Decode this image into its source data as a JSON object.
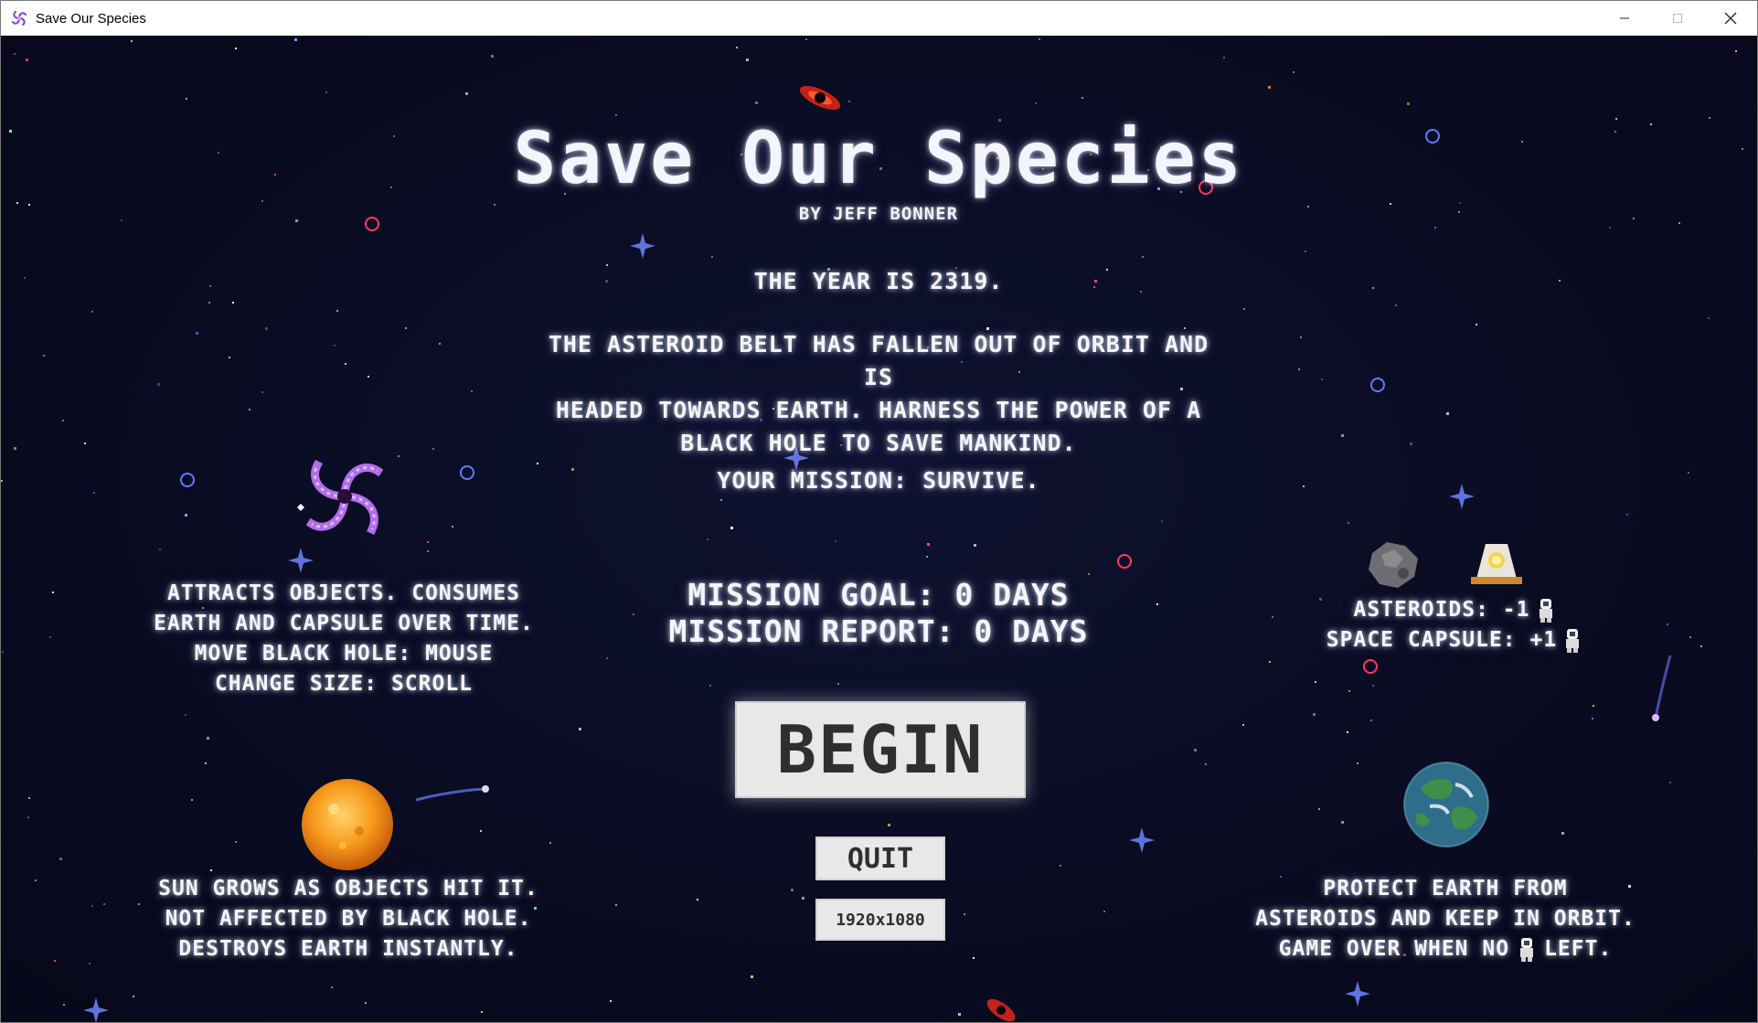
{
  "window": {
    "title": "Save Our Species",
    "app_icon": "spiral-galaxy-icon",
    "controls": [
      "minimize-icon",
      "maximize-icon",
      "close-icon"
    ]
  },
  "game": {
    "title": "Save Our Species",
    "author": "BY JEFF BONNER",
    "intro": {
      "year": "THE YEAR IS 2319.",
      "story_lines": [
        "THE ASTEROID BELT HAS FALLEN OUT OF ORBIT AND IS",
        "HEADED TOWARDS EARTH. HARNESS THE POWER OF A",
        "BLACK HOLE TO SAVE MANKIND."
      ],
      "mission": "YOUR MISSION: SURVIVE."
    },
    "mission_goal": "MISSION GOAL: 0 DAYS",
    "mission_report": "MISSION REPORT: 0 DAYS",
    "buttons": {
      "begin": "BEGIN",
      "quit": "QUIT",
      "resolution": "1920x1080"
    },
    "black_hole_help": [
      "ATTRACTS OBJECTS. CONSUMES",
      "EARTH AND CAPSULE OVER TIME.",
      "MOVE BLACK HOLE: MOUSE",
      "CHANGE SIZE: SCROLL"
    ],
    "sun_help": [
      "SUN GROWS AS OBJECTS HIT IT.",
      "NOT AFFECTED BY BLACK HOLE.",
      "DESTROYS EARTH INSTANTLY."
    ],
    "items_help": {
      "asteroids": "ASTEROIDS: -1",
      "space_capsule": "SPACE CAPSULE: +1"
    },
    "earth_help": {
      "line1": "PROTECT EARTH FROM",
      "line2": "ASTEROIDS AND KEEP IN ORBIT.",
      "line3_start": "GAME OVER WHEN NO",
      "line3_end": "LEFT."
    },
    "icons": [
      "black-hole-galaxy-icon",
      "sun-icon",
      "asteroid-icon",
      "space-capsule-icon",
      "earth-icon",
      "astronaut-icon",
      "comet-icon",
      "red-black-hole-icon"
    ],
    "colors": {
      "background": "#0a0c22",
      "text": "#f4f4ff",
      "button_bg": "#e8e8e8",
      "button_text": "#2f2f2f"
    }
  }
}
